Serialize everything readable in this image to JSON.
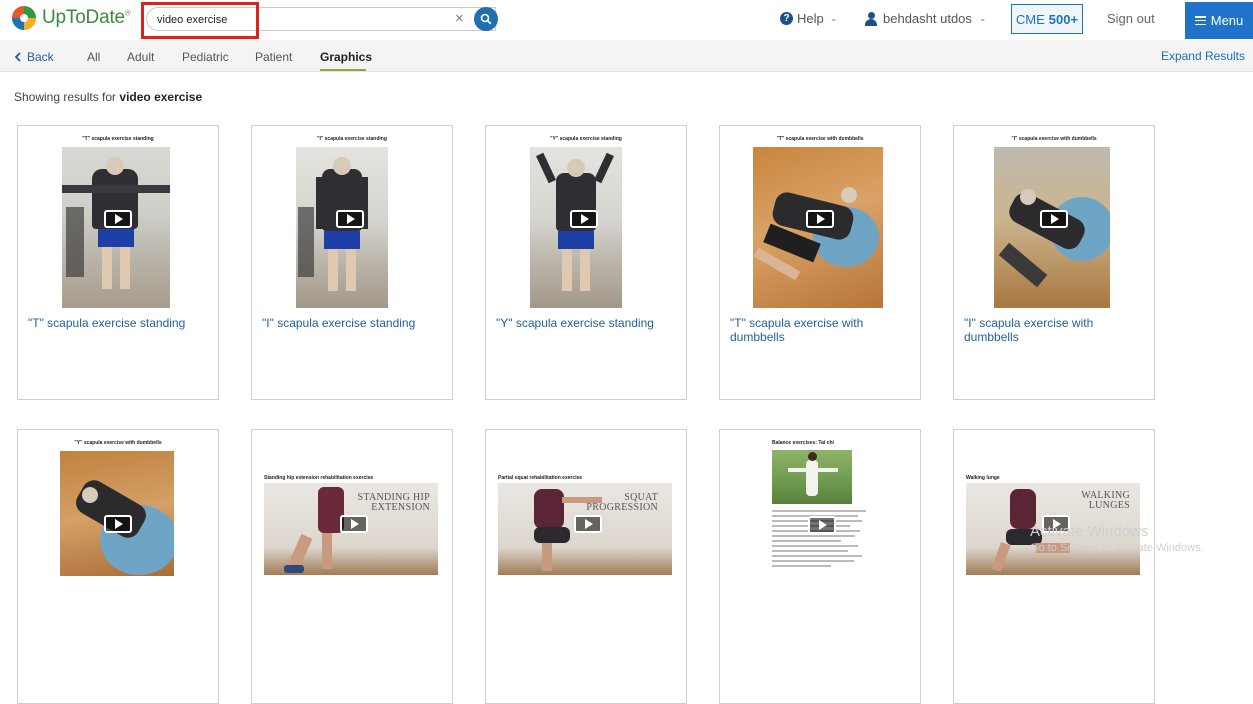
{
  "header": {
    "logo_text": "UpToDate",
    "logo_mark": "®",
    "search_value": "video exercise",
    "help_label": "Help",
    "user_name": "behdasht utdos",
    "cme_prefix": "CME",
    "cme_value": "500+",
    "signout_label": "Sign out",
    "menu_label": "Menu"
  },
  "subnav": {
    "back_label": "Back",
    "tabs": [
      {
        "label": "All"
      },
      {
        "label": "Adult"
      },
      {
        "label": "Pediatric"
      },
      {
        "label": "Patient"
      },
      {
        "label": "Graphics"
      }
    ],
    "expand_label": "Expand Results"
  },
  "results": {
    "showing_prefix": "Showing results for",
    "query": "video exercise"
  },
  "cards": [
    {
      "mini_title": "\"T\" scapula exercise standing",
      "title": "\"T\" scapula exercise standing"
    },
    {
      "mini_title": "\"I\" scapula exercise standing",
      "title": "\"I\" scapula exercise standing"
    },
    {
      "mini_title": "\"Y\" scapula exercise standing",
      "title": "\"Y\" scapula exercise standing"
    },
    {
      "mini_title": "\"T\" scapula exercise with dumbbells",
      "title": "\"T\" scapula exercise with dumbbells"
    },
    {
      "mini_title": "\"I\" scapula exercise with dumbbells",
      "title": "\"I\" scapula exercise with dumbbells"
    },
    {
      "mini_title": "\"Y\" scapula exercise with dumbbells",
      "overlay": ""
    },
    {
      "mini_title": "Standing hip extension rehabilitation exercise",
      "overlay": "STANDING HIP EXTENSION"
    },
    {
      "mini_title": "Partial squat rehabilitation exercise",
      "overlay": "SQUAT PROGRESSION"
    },
    {
      "mini_title": "Balance exercises: Tai chi",
      "overlay": ""
    },
    {
      "mini_title": "Walking lunge",
      "overlay": "WALKING LUNGES"
    }
  ],
  "watermark": {
    "line1": "Activate Windows",
    "line2": "Go to Settings to activate Windows."
  },
  "colors": {
    "brand_green": "#3b8a3e",
    "link_blue": "#1f5f9f",
    "menu_blue": "#1f73c9",
    "highlight_red": "#d9231d",
    "tab_underline": "#8aa944"
  }
}
